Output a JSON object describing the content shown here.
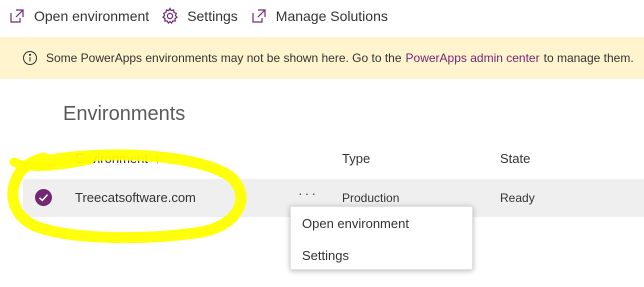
{
  "toolbar": {
    "open_label": "Open environment",
    "settings_label": "Settings",
    "manage_label": "Manage Solutions"
  },
  "banner": {
    "text_before": "Some PowerApps environments may not be shown here. Go to the",
    "link": "PowerApps admin center",
    "text_after": "to manage them."
  },
  "section": {
    "title": "Environments"
  },
  "table": {
    "columns": {
      "environment": "Environment",
      "sort_arrow": "↑",
      "type": "Type",
      "state": "State"
    },
    "rows": [
      {
        "name": "Treecatsoftware.com",
        "more": "···",
        "type": "Production",
        "state": "Ready",
        "selected": true
      }
    ]
  },
  "context_menu": {
    "items": [
      "Open environment",
      "Settings"
    ]
  },
  "colors": {
    "accent": "#742774",
    "banner_bg": "#fff4ce",
    "highlight": "#ffff00",
    "row_bg": "#efefef"
  }
}
